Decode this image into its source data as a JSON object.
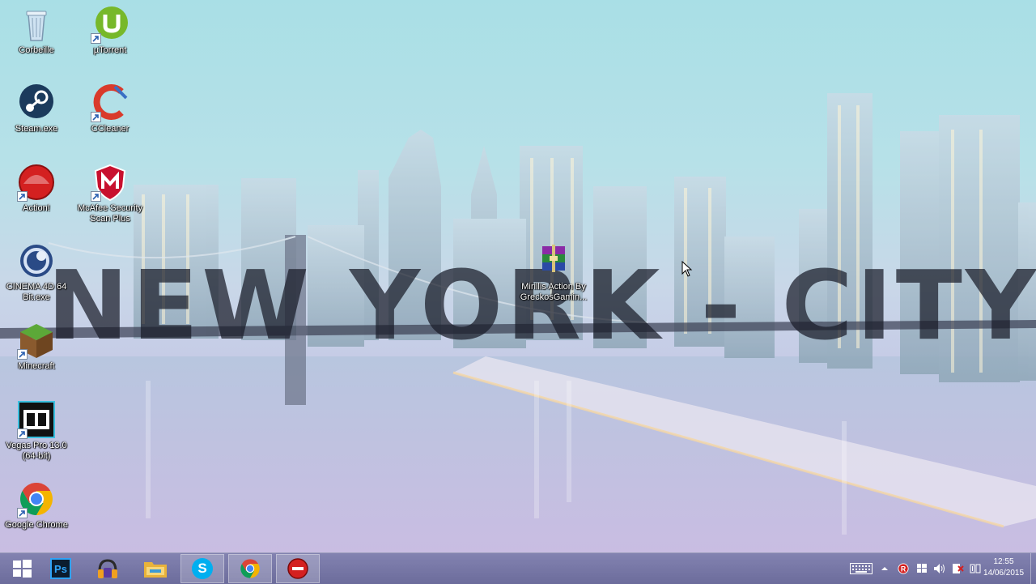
{
  "wallpaper": {
    "text": "NEW YORK - CITY"
  },
  "desktop_icons": [
    {
      "label": "Corbeille",
      "icon": "recycle-bin-icon"
    },
    {
      "label": "µTorrent",
      "icon": "utorrent-icon"
    },
    {
      "label": "Steam.exe",
      "icon": "steam-icon"
    },
    {
      "label": "CCleaner",
      "icon": "ccleaner-icon"
    },
    {
      "label": "Action!",
      "icon": "action-icon"
    },
    {
      "label": "McAfee Security Scan Plus",
      "icon": "mcafee-icon"
    },
    {
      "label": "CINEMA 4D 64 Bit.exe",
      "icon": "cinema4d-icon"
    },
    {
      "label": "Mirillis Action By GreckosGamin...",
      "icon": "winrar-archive-icon"
    },
    {
      "label": "Minecraft",
      "icon": "minecraft-icon"
    },
    {
      "label": "Vegas Pro 13.0 (64-bit)",
      "icon": "vegas-pro-icon"
    },
    {
      "label": "Google Chrome",
      "icon": "chrome-icon"
    }
  ],
  "taskbar": {
    "start_icon": "windows-start-icon",
    "pinned": [
      {
        "app": "Photoshop",
        "icon": "photoshop-icon",
        "text": "Ps"
      },
      {
        "app": "Media Player",
        "icon": "headphones-icon"
      },
      {
        "app": "File Explorer",
        "icon": "folder-icon"
      },
      {
        "app": "Skype",
        "icon": "skype-icon",
        "text": "S"
      },
      {
        "app": "Google Chrome",
        "icon": "chrome-icon"
      },
      {
        "app": "Action!",
        "icon": "record-icon"
      }
    ]
  },
  "tray": {
    "icons": [
      "keyboard-icon",
      "chevron-up-icon",
      "action-tray-icon",
      "flag-icon",
      "volume-icon",
      "power-icon",
      "network-icon"
    ],
    "time": "12:55",
    "date": "14/06/2015"
  },
  "colors": {
    "taskbar": "#6e6ea0",
    "chrome_red": "#db4437",
    "chrome_green": "#0f9d58",
    "chrome_yellow": "#f4b400",
    "chrome_blue": "#4285f4"
  }
}
